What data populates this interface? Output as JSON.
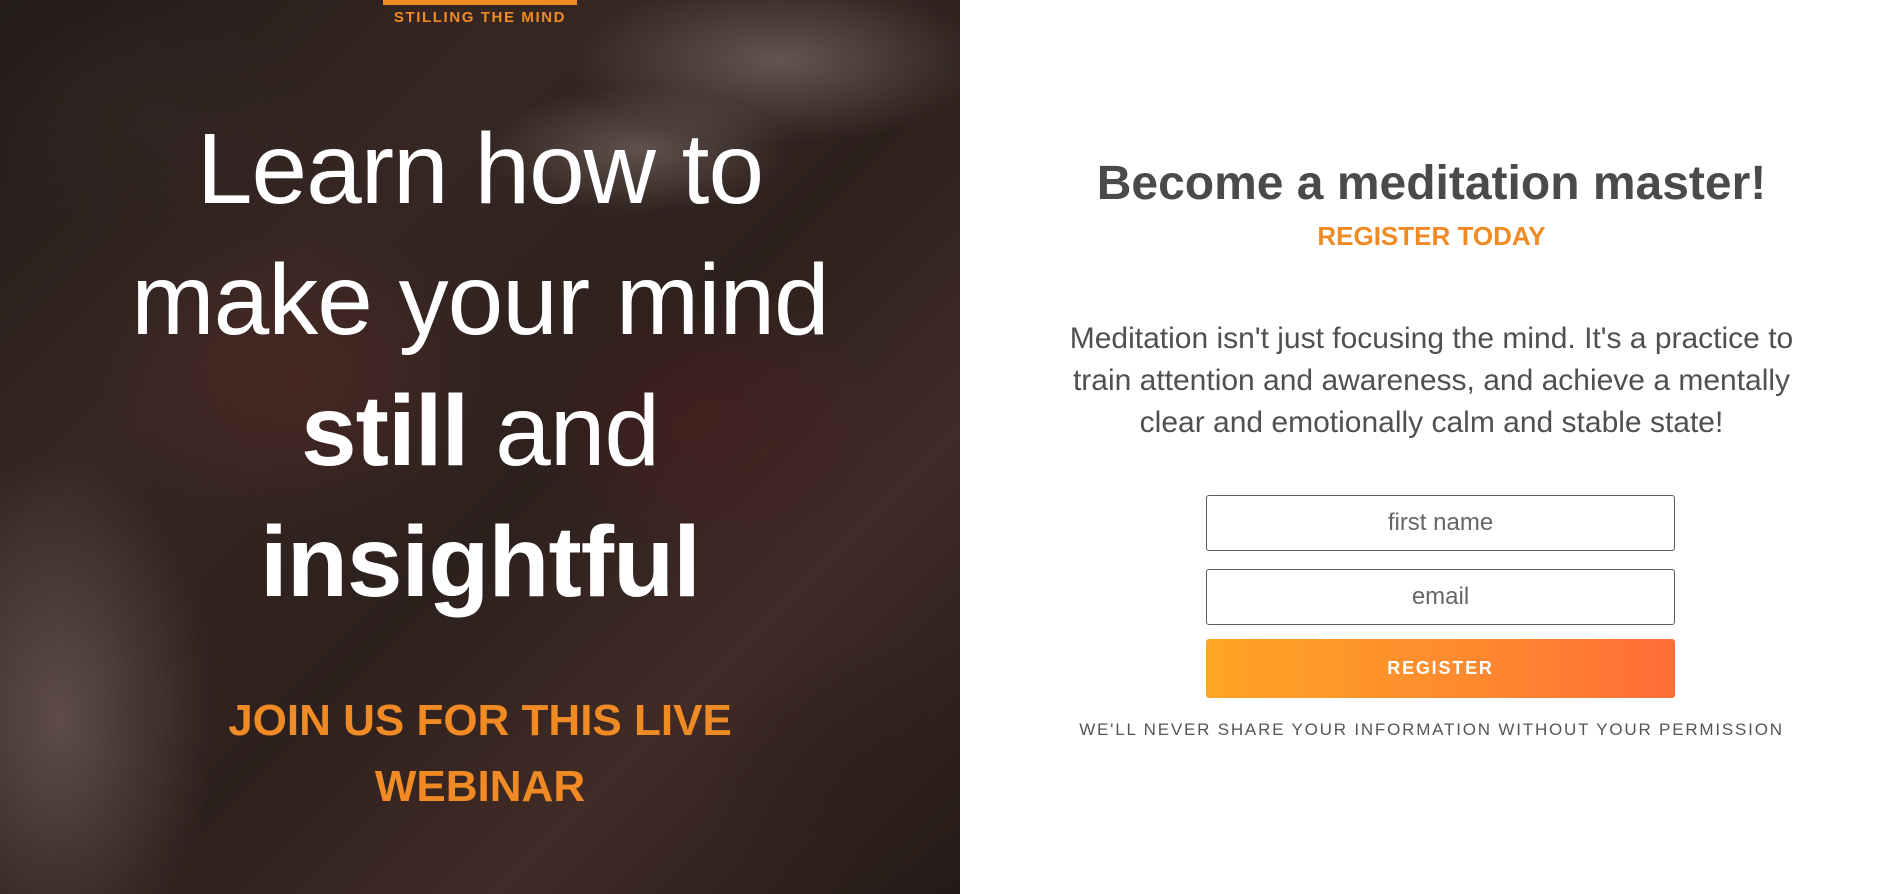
{
  "hero": {
    "brand": "STILLING THE MIND",
    "headline": {
      "line1": "Learn how to",
      "line2": "make your mind",
      "line3_bold": "still",
      "line3_rest": " and",
      "line4_bold": "insightful"
    },
    "webinar_line1": "JOIN US FOR THIS LIVE",
    "webinar_line2": "WEBINAR"
  },
  "panel": {
    "title": "Become a meditation master!",
    "subtitle": "REGISTER TODAY",
    "description": "Meditation isn't just focusing the mind. It's a practice to train attention and awareness, and achieve a mentally clear and emotionally calm and stable state!",
    "form": {
      "first_name_placeholder": "first name",
      "email_placeholder": "email",
      "submit_label": "REGISTER"
    },
    "privacy_note": "WE'LL NEVER SHARE YOUR INFORMATION WITHOUT YOUR PERMISSION"
  },
  "colors": {
    "accent": "#f08a24",
    "button_gradient_start": "#ffa524",
    "button_gradient_end": "#ff6e38",
    "heading": "#4a4a4a"
  }
}
